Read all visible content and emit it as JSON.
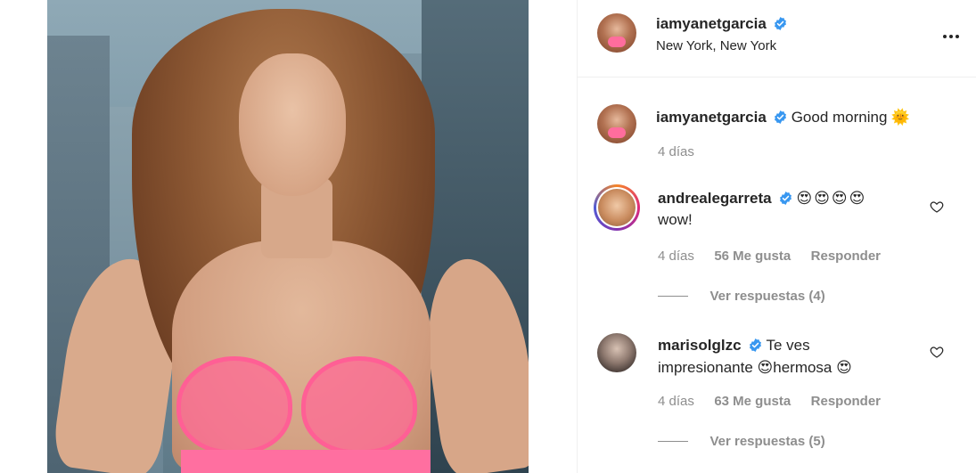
{
  "post": {
    "author": "iamyanetgarcia",
    "location": "New York, New York"
  },
  "caption": {
    "username": "iamyanetgarcia",
    "text": "Good morning",
    "emoji": "🌞",
    "time": "4 días"
  },
  "comments": [
    {
      "username": "andrealegarreta",
      "emoji": "😍😍😍😍",
      "text": "wow!",
      "time": "4 días",
      "likes": "56 Me gusta",
      "reply_label": "Responder",
      "view_replies": "Ver respuestas (4)"
    },
    {
      "username": "marisolglzc",
      "text_1": "Te ves",
      "text_2a": "impresionante",
      "emoji_a": "😍",
      "text_2b": "hermosa",
      "emoji_b": "😍",
      "time": "4 días",
      "likes": "63 Me gusta",
      "reply_label": "Responder",
      "view_replies": "Ver respuestas (5)"
    }
  ],
  "colors": {
    "verified_blue": "#3897f0",
    "text": "#262626",
    "secondary": "#8e8e8e",
    "border": "#efefef"
  }
}
